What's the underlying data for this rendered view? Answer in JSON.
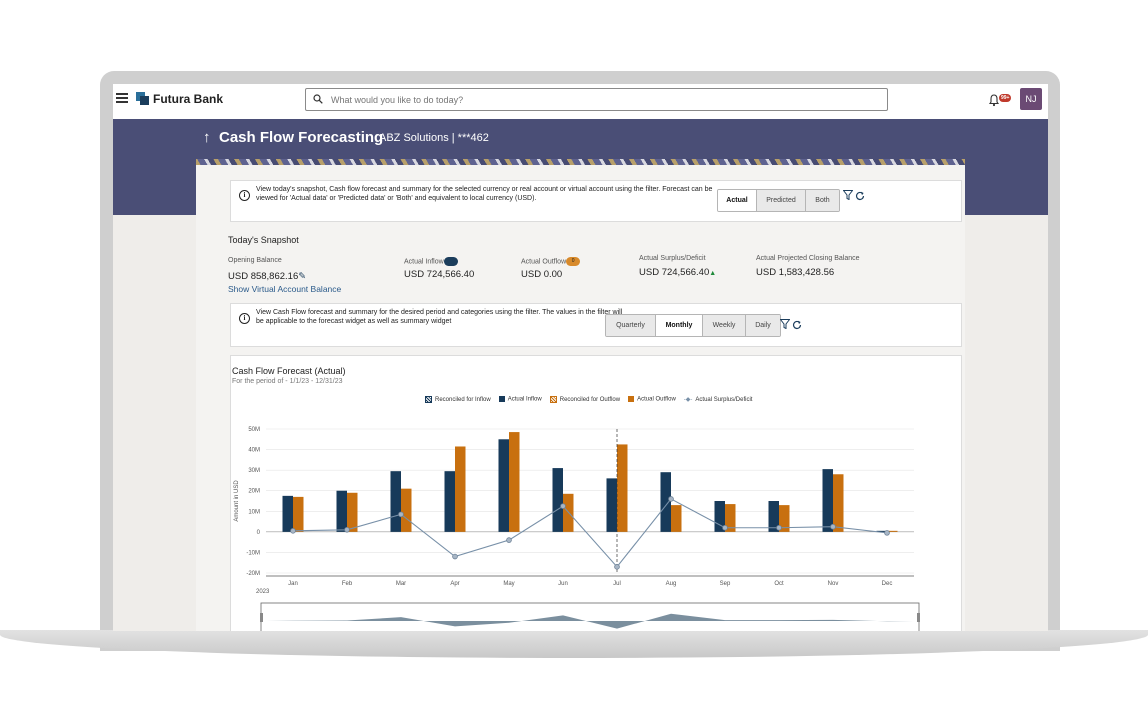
{
  "app": {
    "brand": "Futura Bank",
    "search_placeholder": "What would you like to do today?",
    "notification_count": "99+",
    "user_initials": "NJ"
  },
  "page": {
    "title": "Cash Flow Forecasting",
    "subtitle": "ABZ Solutions | ***462",
    "back_arrow": "↑"
  },
  "filter1": {
    "info": "View today's snapshot, Cash flow forecast and summary for the selected currency or real account or virtual account using the filter. Forecast can be viewed for 'Actual data' or 'Predicted data' or 'Both' and equivalent to local currency (USD).",
    "options": [
      "Actual",
      "Predicted",
      "Both"
    ],
    "selected": "Actual"
  },
  "snapshot": {
    "title": "Today's Snapshot",
    "opening_balance_label": "Opening Balance",
    "opening_balance_value": "USD 858,862.16",
    "show_virtual_link": "Show Virtual Account Balance",
    "inflow_label": "Actual Inflow",
    "inflow_value": "USD 724,566.40",
    "outflow_label": "Actual Outflow",
    "outflow_badge": "0",
    "outflow_value": "USD 0.00",
    "surplus_label": "Actual Surplus/Deficit",
    "surplus_value": "USD 724,566.40",
    "closing_label": "Actual Projected Closing Balance",
    "closing_value": "USD 1,583,428.56"
  },
  "filter2": {
    "info": "View Cash Flow forecast and summary for the desired period and categories using the filter. The values in the filter will be applicable to the forecast widget as well as summary widget",
    "options": [
      "Quarterly",
      "Monthly",
      "Weekly",
      "Daily"
    ],
    "selected": "Monthly"
  },
  "chart_data": {
    "type": "bar",
    "title": "Cash Flow Forecast (Actual)",
    "subtitle": "For the period of - 1/1/23 - 12/31/23",
    "ylabel": "Amount in USD",
    "year_label": "2023",
    "categories": [
      "Jan",
      "Feb",
      "Mar",
      "Apr",
      "May",
      "Jun",
      "Jul",
      "Aug",
      "Sep",
      "Oct",
      "Nov",
      "Dec"
    ],
    "ylim": [
      -20,
      50
    ],
    "y_ticks": [
      "50M",
      "40M",
      "30M",
      "20M",
      "10M",
      "0",
      "-10M",
      "-20M"
    ],
    "legend": [
      "Reconciled for Inflow",
      "Actual Inflow",
      "Reconciled for Outflow",
      "Actual Outflow",
      "Actual Surplus/Deficit"
    ],
    "colors": {
      "inflow": "#173a5a",
      "outflow": "#c8700f",
      "line": "#7890a8"
    },
    "series": [
      {
        "name": "Actual Inflow",
        "values": [
          17.5,
          20,
          29.5,
          29.5,
          45,
          31,
          26,
          29,
          15,
          15,
          30.5,
          0.5
        ]
      },
      {
        "name": "Actual Outflow",
        "values": [
          17,
          19,
          21,
          41.5,
          48.5,
          18.5,
          42.5,
          13,
          13.5,
          13,
          28,
          0.5
        ]
      },
      {
        "name": "Actual Surplus/Deficit",
        "values": [
          0.5,
          1,
          8.5,
          -12,
          -4,
          12.5,
          -17,
          16,
          2,
          2,
          2.5,
          -0.5
        ]
      }
    ],
    "today_marker": "Jul"
  }
}
